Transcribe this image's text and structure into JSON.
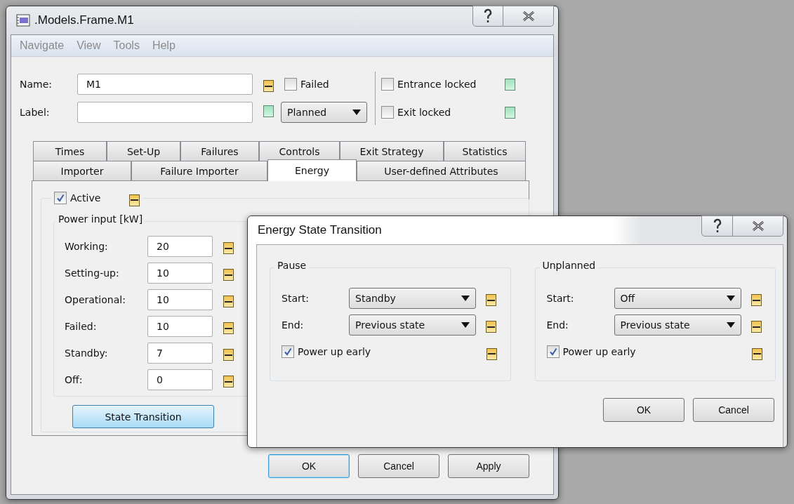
{
  "window": {
    "title": ".Models.Frame.M1"
  },
  "menu": [
    "Navigate",
    "View",
    "Tools",
    "Help"
  ],
  "header": {
    "name": {
      "label": "Name:",
      "value": "M1",
      "inherit": true
    },
    "label_field": {
      "label": "Label:",
      "inherit": false
    },
    "failed": {
      "label": "Failed",
      "checked": false
    },
    "status": {
      "value": "Planned"
    },
    "entrance_locked": {
      "label": "Entrance locked",
      "checked": false,
      "inherit": false
    },
    "exit_locked": {
      "label": "Exit locked",
      "checked": false,
      "inherit": false
    }
  },
  "tab_rows": [
    {
      "tabs": [
        {
          "label": "Times",
          "selected": false
        },
        {
          "label": "Set-Up",
          "selected": false
        },
        {
          "label": "Failures",
          "selected": false
        },
        {
          "label": "Controls",
          "selected": false
        },
        {
          "label": "Exit Strategy",
          "selected": false
        },
        {
          "label": "Statistics",
          "selected": false
        }
      ]
    },
    {
      "tabs": [
        {
          "label": "Importer",
          "selected": false
        },
        {
          "label": "Failure Importer",
          "selected": false
        },
        {
          "label": "Energy",
          "selected": true
        },
        {
          "label": "User-defined Attributes",
          "selected": false
        }
      ]
    }
  ],
  "energy": {
    "active": {
      "label": "Active",
      "checked": true,
      "inherit": true
    },
    "power_input": {
      "title": "Power input [kW]",
      "rows": [
        {
          "label": "Working:",
          "value": "20",
          "inherit": true
        },
        {
          "label": "Setting-up:",
          "value": "10",
          "inherit": true
        },
        {
          "label": "Operational:",
          "value": "10",
          "inherit": true
        },
        {
          "label": "Failed:",
          "value": "10",
          "inherit": true
        },
        {
          "label": "Standby:",
          "value": "7",
          "inherit": true
        },
        {
          "label": "Off:",
          "value": "0",
          "inherit": true
        }
      ]
    },
    "state_transition_button": "State Transition"
  },
  "buttons": [
    {
      "label": "OK",
      "default": true
    },
    {
      "label": "Cancel",
      "default": false
    },
    {
      "label": "Apply",
      "default": false
    }
  ],
  "dialog": {
    "title": "Energy State Transition",
    "groups": [
      {
        "title": "Pause",
        "start": {
          "label": "Start:",
          "value": "Standby",
          "inherit": true
        },
        "end": {
          "label": "End:",
          "value": "Previous state",
          "inherit": true
        },
        "power_up": {
          "label": "Power up early",
          "checked": true,
          "inherit": true
        }
      },
      {
        "title": "Unplanned",
        "start": {
          "label": "Start:",
          "value": "Off",
          "inherit": true
        },
        "end": {
          "label": "End:",
          "value": "Previous state",
          "inherit": true
        },
        "power_up": {
          "label": "Power up early",
          "checked": true,
          "inherit": true
        }
      }
    ],
    "buttons": [
      {
        "label": "OK",
        "default": false
      },
      {
        "label": "Cancel",
        "default": false
      }
    ]
  }
}
